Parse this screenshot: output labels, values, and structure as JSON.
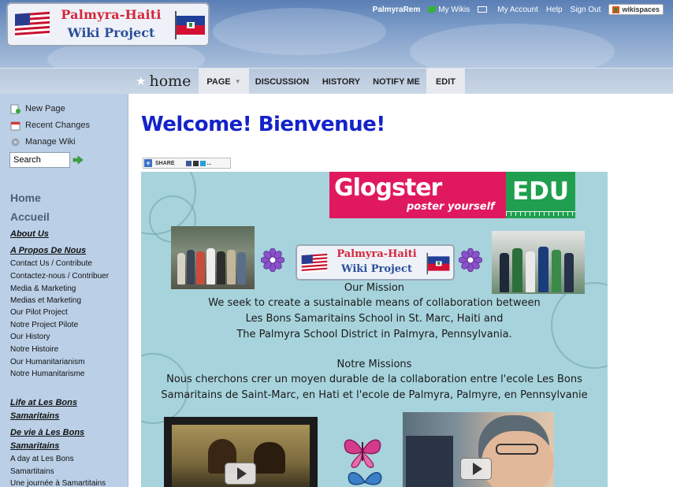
{
  "header": {
    "logo": {
      "line1": "Palmyra-Haiti",
      "line2": "Wiki Project"
    },
    "topnav": {
      "username": "PalmyraRem",
      "my_wikis": "My Wikis",
      "my_account": "My Account",
      "help": "Help",
      "sign_out": "Sign Out",
      "brand": "wikispaces"
    }
  },
  "tabbar": {
    "page_name": "home",
    "tabs": [
      {
        "label": "PAGE"
      },
      {
        "label": "DISCUSSION"
      },
      {
        "label": "HISTORY"
      },
      {
        "label": "NOTIFY ME"
      },
      {
        "label": "EDIT"
      }
    ]
  },
  "sidebar": {
    "tools": [
      {
        "label": "New Page",
        "icon": "new-page-icon"
      },
      {
        "label": "Recent Changes",
        "icon": "calendar-icon"
      },
      {
        "label": "Manage Wiki",
        "icon": "gear-icon"
      }
    ],
    "search": {
      "value": "Search"
    },
    "nav": {
      "home": "Home",
      "accueil": "Accueil",
      "about_us": "About Us",
      "a_propos": "A Propos De Nous",
      "links1": [
        "Contact Us / Contribute",
        "Contactez-nous / Contribuer",
        "Media & Marketing",
        "Medias et Marketing",
        "Our Pilot Project",
        "Notre Project Pilote",
        "Our History",
        "Notre Histoire",
        "Our Humanitarianism",
        "Notre Humanitarisme"
      ],
      "life_line1": "Life at Les Bons",
      "life_line2": "Samaritains",
      "devie_line1": "De vie à Les Bons",
      "devie_line2": "Samaritains",
      "links2": [
        "A day at Les Bons",
        "Samartitains",
        "Une journée à Samartitains"
      ]
    }
  },
  "main": {
    "title": "Welcome!  Bienvenue!",
    "share_label": "SHARE",
    "glog": {
      "brand_word": "Glogster",
      "brand_tagline": "poster yourself",
      "brand_edu": "EDU",
      "logo_line1": "Palmyra-Haiti",
      "logo_line2": "Wiki Project",
      "lines": [
        "Our Mission",
        "We seek to create a sustainable means of collaboration between",
        "Les Bons Samaritains School in St. Marc, Haiti and",
        "The Palmyra School District in Palmyra, Pennsylvania.",
        "Notre Missions",
        "Nous cherchons  crer un moyen durable de la collaboration entre l'ecole Les Bons",
        "Samaritains de Saint-Marc, en Hati et l'ecole de Palmyra,  Palmyre, en Pennsylvanie"
      ]
    }
  },
  "colors": {
    "title_blue": "#1423c8",
    "sidebar_bg": "#bbd0e7",
    "glog_bg": "#a7d3dc",
    "glogster_pink": "#e0195e",
    "edu_green": "#1f9f4f"
  }
}
